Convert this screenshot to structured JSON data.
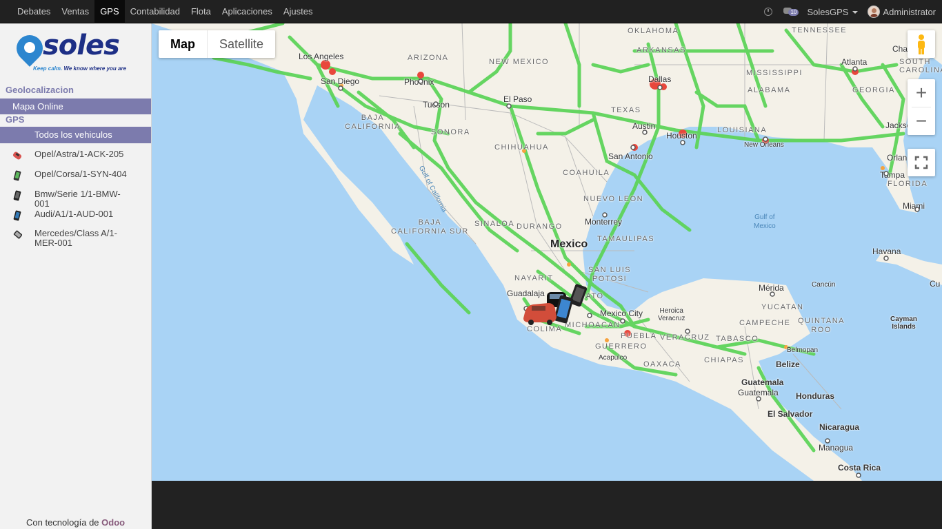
{
  "menu": [
    "Debates",
    "Ventas",
    "GPS",
    "Contabilidad",
    "Flota",
    "Aplicaciones",
    "Ajustes"
  ],
  "topbar": {
    "notifications": "10",
    "company": "SolesGPS",
    "user": "Administrator"
  },
  "logo": {
    "word": "soles",
    "tagline_a": "Keep calm.",
    "tagline_b": " We know where you are"
  },
  "sidebar": {
    "section1": "Geolocalizacion",
    "mapa_online": "Mapa Online",
    "section2": "GPS",
    "todos": "Todos los vehiculos",
    "vehicles": [
      {
        "label": "Opel/Astra/1-ACK-205",
        "color": "#d9534f"
      },
      {
        "label": "Opel/Corsa/1-SYN-404",
        "color": "#5cb85c"
      },
      {
        "label": "Bmw/Serie 1/1-BMW-001",
        "color": "#444444"
      },
      {
        "label": "Audi/A1/1-AUD-001",
        "color": "#337ab7"
      },
      {
        "label": "Mercedes/Class A/1-MER-001",
        "color": "#888888"
      }
    ],
    "powered_prefix": "Con tecnología de ",
    "powered_brand": "Odoo"
  },
  "map": {
    "type_map": "Map",
    "type_satellite": "Satellite",
    "zoom_in": "+",
    "zoom_out": "−",
    "labels": {
      "mexico": "Mexico",
      "oklahoma": "OKLAHOMA",
      "tennessee": "TENNESSEE",
      "arkansas": "ARKANSAS",
      "cha": "Cha",
      "losangeles": "Los Angeles",
      "arizona": "ARIZONA",
      "newmexico": "NEW MEXICO",
      "mississippi": "MISSISSIPPI",
      "atlanta": "Atlanta",
      "southcarolina": "SOUTH\nCAROLINA",
      "sandiego": "San Diego",
      "phoenix": "Phoenix",
      "dallas": "Dallas",
      "alabama": "ALABAMA",
      "georgia": "GEORGIA",
      "elpaso": "El Paso",
      "tucson": "Tucson",
      "texas": "TEXAS",
      "bajacalifornia": "BAJA\nCALIFORNIA",
      "austin": "Austin",
      "houston": "Houston",
      "louisiana": "LOUISIANA",
      "jackson": "Jackson",
      "sonora": "SONORA",
      "neworleans": "New Orleans",
      "chihuahua": "CHIHUAHUA",
      "sanantonio": "San Antonio",
      "orlando": "Orlan",
      "tampa": "Tampa",
      "gulfcalifornia": "Gulf of California",
      "coahuila": "COAHUILA",
      "florida": "FLORIDA",
      "nuevoleon": "NUEVO LEON",
      "miami": "Miami",
      "gulfmexico": "Gulf of\nMexico",
      "bajacaliforniasur": "BAJA\nCALIFORNIA SUR",
      "sinaloa": "SINALOA",
      "durango": "DURANGO",
      "monterrey": "Monterrey",
      "tamaulipas": "TAMAULIPAS",
      "havana": "Havana",
      "sanluis": "SAN LUIS\nPOTOSI",
      "nayarit": "NAYARIT",
      "merida": "Mérida",
      "cancun": "Cancún",
      "cu": "Cu",
      "guadalajara": "Guadalaja",
      "guanajuato": "JUATO",
      "mexicocity": "Mexico City",
      "heroica": "Heroica\nVeracruz",
      "yucatan": "YUCATAN",
      "michoacan": "MICHOACAN",
      "colima": "COLIMA",
      "campeche": "CAMPECHE",
      "quintana": "QUINTANA\nROO",
      "caymans": "Cayman\nIslands",
      "puebla": "PUEBLA",
      "veracruz": "VERACRUZ",
      "tabasco": "TABASCO",
      "guerrero": "GUERRERO",
      "belmopan": "Belmopan",
      "acapulco": "Acapulco",
      "oaxaca": "OAXACA",
      "chiapas": "CHIAPAS",
      "belize": "Belize",
      "guatemala1": "Guatemala",
      "guatemala2": "Guatemala",
      "honduras": "Honduras",
      "elsalvador": "El Salvador",
      "nicaragua": "Nicaragua",
      "managua": "Managua",
      "costarica": "Costa Rica"
    }
  }
}
